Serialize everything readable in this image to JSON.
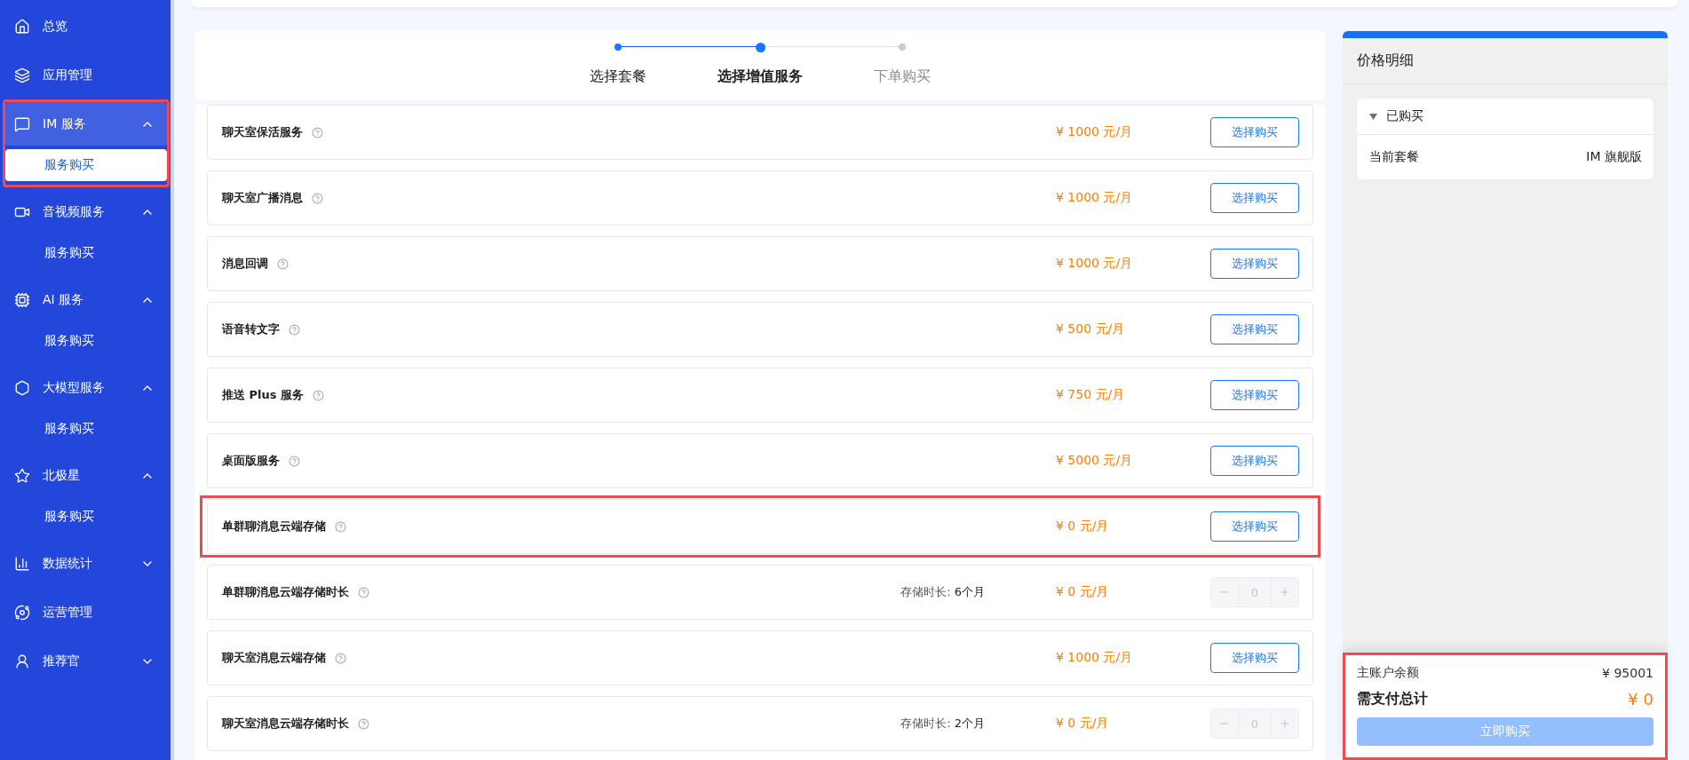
{
  "sidebar": {
    "items": [
      {
        "kind": "link",
        "label": "总览",
        "highlighted": false
      },
      {
        "kind": "link",
        "label": "应用管理",
        "highlighted": false
      },
      {
        "kind": "group",
        "label": "IM 服务",
        "expanded": true,
        "highlighted": true,
        "children": [
          {
            "label": "服务购买",
            "selected": true
          }
        ]
      },
      {
        "kind": "group",
        "label": "音视频服务",
        "expanded": true,
        "highlighted": false,
        "children": [
          {
            "label": "服务购买",
            "selected": false
          }
        ]
      },
      {
        "kind": "group",
        "label": "AI 服务",
        "expanded": true,
        "highlighted": false,
        "children": [
          {
            "label": "服务购买",
            "selected": false
          }
        ]
      },
      {
        "kind": "group",
        "label": "大模型服务",
        "expanded": true,
        "highlighted": false,
        "children": [
          {
            "label": "服务购买",
            "selected": false
          }
        ]
      },
      {
        "kind": "group",
        "label": "北极星",
        "expanded": true,
        "highlighted": false,
        "children": [
          {
            "label": "服务购买",
            "selected": false
          }
        ]
      },
      {
        "kind": "group",
        "label": "数据统计",
        "expanded": false,
        "highlighted": false
      },
      {
        "kind": "link",
        "label": "运营管理",
        "highlighted": false
      },
      {
        "kind": "group",
        "label": "推荐官",
        "expanded": false,
        "highlighted": false
      }
    ]
  },
  "steps": [
    {
      "label": "选择套餐",
      "reached": true,
      "selected": false
    },
    {
      "label": "选择增值服务",
      "reached": true,
      "selected": true
    },
    {
      "label": "下单购买",
      "reached": false,
      "selected": false
    }
  ],
  "rows": [
    {
      "kind": "select",
      "name": "聊天室保活服务",
      "price": "¥ 1000 元/月",
      "button": "选择购买",
      "highlighted": false
    },
    {
      "kind": "select",
      "name": "聊天室广播消息",
      "price": "¥ 1000 元/月",
      "button": "选择购买",
      "highlighted": false
    },
    {
      "kind": "select",
      "name": "消息回调",
      "price": "¥ 1000 元/月",
      "button": "选择购买",
      "highlighted": false
    },
    {
      "kind": "select",
      "name": "语音转文字",
      "price": "¥ 500 元/月",
      "button": "选择购买",
      "highlighted": false
    },
    {
      "kind": "select",
      "name": "推送 Plus 服务",
      "price": "¥ 750 元/月",
      "button": "选择购买",
      "highlighted": false
    },
    {
      "kind": "select",
      "name": "桌面版服务",
      "price": "¥ 5000 元/月",
      "button": "选择购买",
      "highlighted": false
    },
    {
      "kind": "select",
      "name": "单群聊消息云端存储",
      "price": "¥ 0 元/月",
      "button": "选择购买",
      "highlighted": true
    },
    {
      "kind": "stepper",
      "name": "单群聊消息云端存储时长",
      "duration_label": "存储时长:",
      "duration": "6个月",
      "price": "¥ 0 元/月",
      "value": "0",
      "disabled": true,
      "highlighted": false
    },
    {
      "kind": "select",
      "name": "聊天室消息云端存储",
      "price": "¥ 1000 元/月",
      "button": "选择购买",
      "highlighted": false
    },
    {
      "kind": "stepper",
      "name": "聊天室消息云端存储时长",
      "duration_label": "存储时长:",
      "duration": "2个月",
      "price": "¥ 0 元/月",
      "value": "0",
      "disabled": true,
      "highlighted": false
    }
  ],
  "price_panel": {
    "title": "价格明细",
    "section": {
      "title": "已购买",
      "expanded": true,
      "label": "当前套餐",
      "value": "IM 旗舰版"
    },
    "summary": {
      "highlighted": true,
      "balance_label": "主账户余额",
      "balance": "¥ 95001",
      "total_label": "需支付总计",
      "total": "¥ 0",
      "button": "立即购买",
      "button_disabled": true
    }
  }
}
